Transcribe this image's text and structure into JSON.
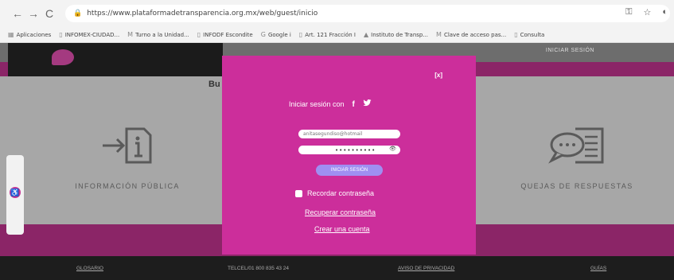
{
  "browser": {
    "url": "https://www.plataformadetransparencia.org.mx/web/guest/inicio",
    "nav": {
      "back": "←",
      "forward": "→",
      "reload": "C"
    },
    "icons": [
      "key-icon",
      "star-icon",
      "profile-icon"
    ],
    "bookmarks": [
      "Aplicaciones",
      "INFOMEX-CIUDAD...",
      "Turno a la Unidad...",
      "INFODF Escondite",
      "Google i",
      "Art. 121 Fracción I",
      "Instituto de Transp...",
      "Clave de acceso pas...",
      "Consulta"
    ]
  },
  "site": {
    "top_login": "INICIAR SESIÓN",
    "search_heading": "Bu",
    "cards": [
      {
        "label": "INFORMACIÓN PÚBLICA",
        "icon": "info-document-icon"
      },
      {
        "label": "QUEJAS DE RESPUESTAS",
        "icon": "chat-document-icon"
      }
    ],
    "footer": {
      "glossary": "GLOSARIO",
      "phone": "TELCEL/01 800 835 43 24",
      "privacy": "AVISO DE PRIVACIDAD",
      "guide": "GUÍAS"
    }
  },
  "modal": {
    "close_label": "[x]",
    "social_title": "Iniciar sesión con",
    "social_icons": [
      "facebook-icon",
      "twitter-icon"
    ],
    "username_value": "anitasegundiso@hotmail",
    "password_value": "••••••••••",
    "login_button": "INICIAR SESIÓN",
    "remember_label": "Recordar contraseña",
    "recover_link": "Recuperar contraseña",
    "create_link": "Crear una cuenta"
  },
  "colors": {
    "modal": "#cc2e9b",
    "brand_dark": "#8b2567",
    "button": "#9f8ff2",
    "footer": "#1d1d1d"
  }
}
